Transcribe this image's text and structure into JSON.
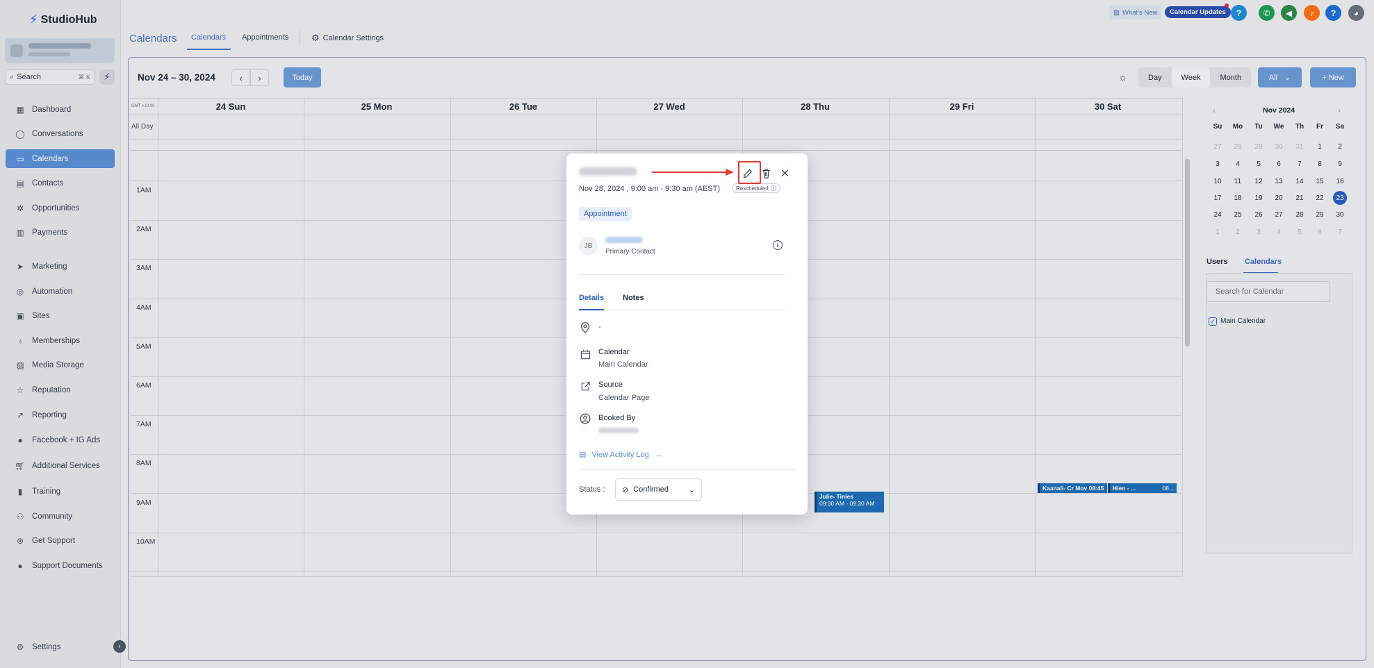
{
  "app": {
    "brand": "StudioHub",
    "title": "Calendars"
  },
  "sidebar": {
    "search_label": "Search",
    "search_shortcut": "⌘ K",
    "items": [
      {
        "label": "Dashboard",
        "icon": "dashboard-icon"
      },
      {
        "label": "Conversations",
        "icon": "chat-icon"
      },
      {
        "label": "Calendars",
        "icon": "calendar-icon",
        "active": true
      },
      {
        "label": "Contacts",
        "icon": "contacts-icon"
      },
      {
        "label": "Opportunities",
        "icon": "opportunities-icon"
      },
      {
        "label": "Payments",
        "icon": "payments-icon"
      },
      {
        "label": "Marketing",
        "icon": "send-icon"
      },
      {
        "label": "Automation",
        "icon": "automation-icon"
      },
      {
        "label": "Sites",
        "icon": "sites-icon"
      },
      {
        "label": "Memberships",
        "icon": "memberships-icon"
      },
      {
        "label": "Media Storage",
        "icon": "image-icon"
      },
      {
        "label": "Reputation",
        "icon": "star-icon"
      },
      {
        "label": "Reporting",
        "icon": "chart-icon"
      },
      {
        "label": "Facebook + IG Ads",
        "icon": "facebook-icon"
      },
      {
        "label": "Additional Services",
        "icon": "cart-icon"
      },
      {
        "label": "Training",
        "icon": "book-icon"
      },
      {
        "label": "Community",
        "icon": "community-icon"
      },
      {
        "label": "Get Support",
        "icon": "support-icon"
      },
      {
        "label": "Support Documents",
        "icon": "info-icon"
      }
    ],
    "settings_label": "Settings"
  },
  "header": {
    "whats_new": "What's New",
    "calendar_updates": "Calendar Updates",
    "tabs": [
      {
        "label": "Calendars",
        "active": true
      },
      {
        "label": "Appointments"
      },
      {
        "label": "Calendar Settings"
      }
    ]
  },
  "toolbar": {
    "range": "Nov 24 – 30, 2024",
    "today": "Today",
    "views": [
      "Day",
      "Week",
      "Month"
    ],
    "active_view": "Week",
    "filter": "All",
    "new": "+ New"
  },
  "week": {
    "timezone": "GMT +10:00",
    "all_day": "All Day",
    "days": [
      "24 Sun",
      "25 Mon",
      "26 Tue",
      "27 Wed",
      "28 Thu",
      "29 Fri",
      "30 Sat"
    ],
    "hours": [
      "1AM",
      "2AM",
      "3AM",
      "4AM",
      "5AM",
      "6AM",
      "7AM",
      "8AM",
      "9AM",
      "10AM"
    ],
    "events": [
      {
        "title": "Julie- Tinies",
        "time": "09:00 AM - 09:30 AM"
      },
      {
        "title": "Kaanali- Cr Mov 08:45",
        "time": ""
      },
      {
        "title": "Hien - ...",
        "time": "08..."
      }
    ]
  },
  "mini_calendar": {
    "month": "Nov 2024",
    "weekdays": [
      "Su",
      "Mo",
      "Tu",
      "We",
      "Th",
      "Fr",
      "Sa"
    ],
    "weeks": [
      [
        "27",
        "28",
        "29",
        "30",
        "31",
        "1",
        "2"
      ],
      [
        "3",
        "4",
        "5",
        "6",
        "7",
        "8",
        "9"
      ],
      [
        "10",
        "11",
        "12",
        "13",
        "14",
        "15",
        "16"
      ],
      [
        "17",
        "18",
        "19",
        "20",
        "21",
        "22",
        "23"
      ],
      [
        "24",
        "25",
        "26",
        "27",
        "28",
        "29",
        "30"
      ],
      [
        "1",
        "2",
        "3",
        "4",
        "5",
        "6",
        "7"
      ]
    ],
    "today": "23"
  },
  "side_panel": {
    "tabs": [
      "Users",
      "Calendars"
    ],
    "active_tab": "Calendars",
    "search_placeholder": "Search for Calendar",
    "calendars": [
      "Main Calendar"
    ]
  },
  "modal": {
    "datetime": "Nov 28, 2024 , 9:00 am - 9:30 am (AEST)",
    "badge": "Rescheduled",
    "type_chip": "Appointment",
    "contact_initials": "JB",
    "contact_role": "Primary Contact",
    "tabs": [
      "Details",
      "Notes"
    ],
    "location": "-",
    "calendar_label": "Calendar",
    "calendar_value": "Main Calendar",
    "source_label": "Source",
    "source_value": "Calendar Page",
    "booked_by_label": "Booked By",
    "activity_log": "View Activity Log",
    "status_label": "Status :",
    "status_value": "Confirmed"
  },
  "colors": {
    "accent": "#2b5fc4",
    "sidebar_active": "#5b8fd6",
    "event": "#1f6fb8",
    "highlight": "#e53935"
  }
}
